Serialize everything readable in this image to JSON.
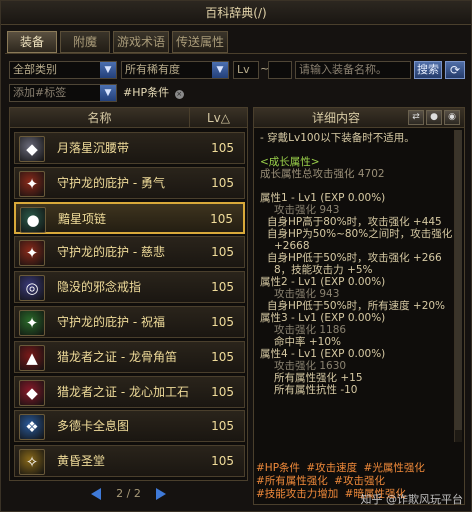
{
  "window": {
    "title": "百科辞典(/)"
  },
  "tabs": [
    {
      "label": "装备",
      "active": true
    },
    {
      "label": "附魔",
      "active": false
    },
    {
      "label": "游戏术语",
      "active": false
    },
    {
      "label": "传送属性",
      "active": false
    }
  ],
  "filters": {
    "category": "全部类别",
    "rarity": "所有稀有度",
    "lv_label": "Lv",
    "lv_separator": "~",
    "search_placeholder": "请输入装备名称。",
    "search_button": "搜索",
    "refresh_icon": "refresh-icon",
    "tag_placeholder": "添加#标签",
    "active_tag": "#HP条件"
  },
  "list": {
    "col_name": "名称",
    "col_lv": "Lv△",
    "items": [
      {
        "name": "月落星沉腰带",
        "lv": "105",
        "icon": "belt-icon",
        "color": "#6a6a7a",
        "glyph": "◆",
        "selected": false
      },
      {
        "name": "守护龙的庇护 - 勇气",
        "lv": "105",
        "icon": "dragon-armor-icon",
        "color": "#8a2a1a",
        "glyph": "✦",
        "selected": false
      },
      {
        "name": "黯星项链",
        "lv": "105",
        "icon": "necklace-icon",
        "color": "#2a5a4a",
        "glyph": "●",
        "selected": true
      },
      {
        "name": "守护龙的庇护 - 慈悲",
        "lv": "105",
        "icon": "dragon-armor-icon",
        "color": "#8a2a1a",
        "glyph": "✦",
        "selected": false
      },
      {
        "name": "隐没的邪念戒指",
        "lv": "105",
        "icon": "ring-icon",
        "color": "#3a3a7a",
        "glyph": "◎",
        "selected": false
      },
      {
        "name": "守护龙的庇护 - 祝福",
        "lv": "105",
        "icon": "dragon-armor-icon",
        "color": "#2a6a2a",
        "glyph": "✦",
        "selected": false
      },
      {
        "name": "猎龙者之证 - 龙骨角笛",
        "lv": "105",
        "icon": "horn-icon",
        "color": "#7a1a1a",
        "glyph": "▲",
        "selected": false
      },
      {
        "name": "猎龙者之证 - 龙心加工石",
        "lv": "105",
        "icon": "stone-icon",
        "color": "#8a1a2a",
        "glyph": "◆",
        "selected": false
      },
      {
        "name": "多德卡全息图",
        "lv": "105",
        "icon": "hologram-icon",
        "color": "#2a5a9a",
        "glyph": "❖",
        "selected": false
      },
      {
        "name": "黄昏圣堂",
        "lv": "105",
        "icon": "chapel-icon",
        "color": "#8a6a1a",
        "glyph": "✧",
        "selected": false
      }
    ]
  },
  "pager": {
    "text": "2 / 2"
  },
  "detail": {
    "header": "详细内容",
    "lines": [
      {
        "text": "- 穿戴Lv100以下装备时不适用。",
        "color": "#d6c9a3",
        "indent": 0
      },
      {
        "text": "",
        "color": "#d6c9a3",
        "indent": 0
      },
      {
        "text": "<成长属性>",
        "color": "#9ad04a",
        "indent": 0
      },
      {
        "text": "成长属性总攻击强化 4702",
        "color": "#9a8f78",
        "indent": 0
      },
      {
        "text": "",
        "color": "#d6c9a3",
        "indent": 0
      },
      {
        "text": "属性1 - Lv1 (EXP 0.00%)",
        "color": "#d6c9a3",
        "indent": 0
      },
      {
        "text": "攻击强化 943",
        "color": "#8a8270",
        "indent": 2
      },
      {
        "text": "自身HP高于80%时，攻击强化 +445",
        "color": "#d6c9a3",
        "indent": 1
      },
      {
        "text": "自身HP为50%~80%之间时，攻击强化",
        "color": "#d6c9a3",
        "indent": 1
      },
      {
        "text": "+2668",
        "color": "#d6c9a3",
        "indent": 2
      },
      {
        "text": "自身HP低于50%时，攻击强化 +266",
        "color": "#d6c9a3",
        "indent": 1
      },
      {
        "text": "8，技能攻击力 +5%",
        "color": "#d6c9a3",
        "indent": 2
      },
      {
        "text": "属性2 - Lv1 (EXP 0.00%)",
        "color": "#d6c9a3",
        "indent": 0
      },
      {
        "text": "攻击强化 943",
        "color": "#8a8270",
        "indent": 2
      },
      {
        "text": "自身HP低于50%时，所有速度 +20%",
        "color": "#d6c9a3",
        "indent": 1
      },
      {
        "text": "属性3 - Lv1 (EXP 0.00%)",
        "color": "#d6c9a3",
        "indent": 0
      },
      {
        "text": "攻击强化 1186",
        "color": "#8a8270",
        "indent": 2
      },
      {
        "text": "命中率 +10%",
        "color": "#d6c9a3",
        "indent": 2
      },
      {
        "text": "属性4 - Lv1 (EXP 0.00%)",
        "color": "#d6c9a3",
        "indent": 0
      },
      {
        "text": "攻击强化 1630",
        "color": "#8a8270",
        "indent": 2
      },
      {
        "text": "所有属性强化 +15",
        "color": "#d6c9a3",
        "indent": 2
      },
      {
        "text": "所有属性抗性 -10",
        "color": "#d6c9a3",
        "indent": 2
      }
    ],
    "tags": [
      "#HP条件",
      "#攻击速度",
      "#光属性强化",
      "#所有属性强化",
      "#攻击强化",
      "#技能攻击力增加",
      "#暗属性强化"
    ]
  },
  "watermark": "知乎 @诈欺风玩平台"
}
